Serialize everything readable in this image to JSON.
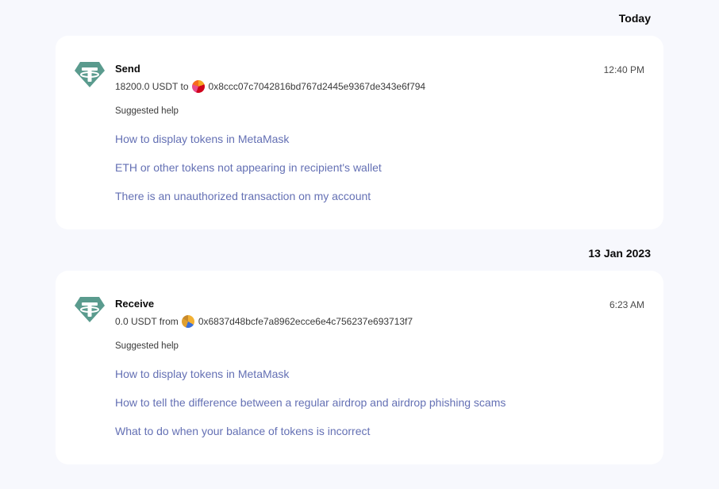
{
  "groups": [
    {
      "date": "Today",
      "transaction": {
        "type": "Send",
        "amount_text": "18200.0 USDT to",
        "address": "0x8ccc07c7042816bd767d2445e9367de343e6f794",
        "time": "12:40 PM",
        "suggested_help_label": "Suggested help",
        "help_links": [
          "How to display tokens in MetaMask",
          "ETH or other tokens not appearing in recipient's wallet",
          "There is an unauthorized transaction on my account"
        ]
      }
    },
    {
      "date": "13 Jan 2023",
      "transaction": {
        "type": "Receive",
        "amount_text": "0.0 USDT from",
        "address": "0x6837d48bcfe7a8962ecce6e4c756237e693713f7",
        "time": "6:23 AM",
        "suggested_help_label": "Suggested help",
        "help_links": [
          "How to display tokens in MetaMask",
          "How to tell the difference between a regular airdrop and airdrop phishing scams",
          "What to do when your balance of tokens is incorrect"
        ]
      }
    }
  ],
  "colors": {
    "page_background": "#f7f8fd",
    "card_background": "#ffffff",
    "link": "#6470b4",
    "token_icon": "#5a9b8e"
  },
  "icons": {
    "token": "tether-usdt-icon",
    "send_avatar": "address-avatar-icon",
    "receive_avatar": "address-avatar-icon"
  }
}
